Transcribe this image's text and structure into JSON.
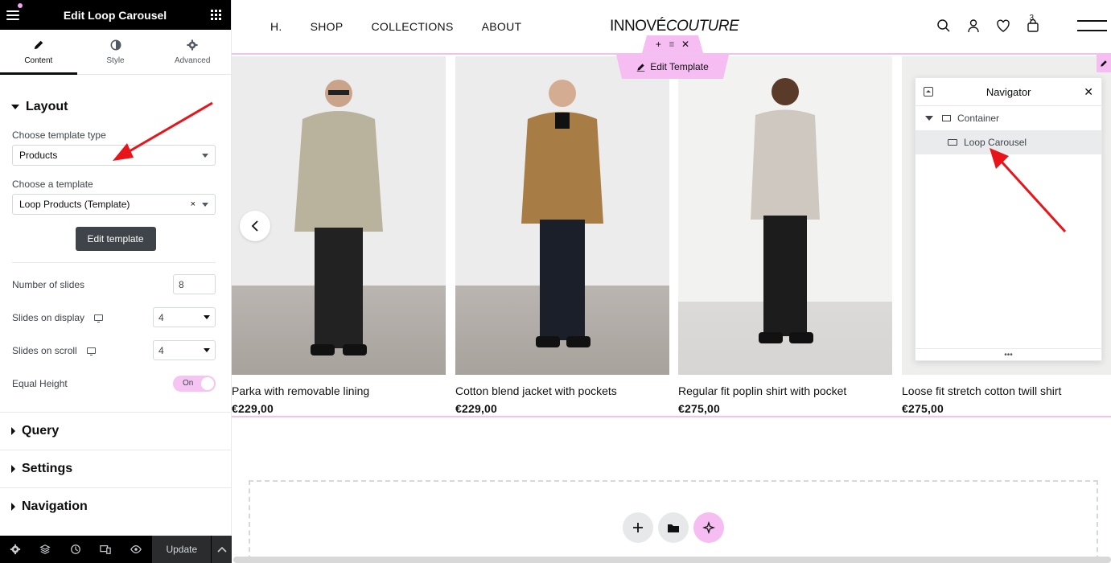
{
  "editor": {
    "title": "Edit Loop Carousel",
    "tabs": [
      {
        "label": "Content",
        "icon": "pencil-icon"
      },
      {
        "label": "Style",
        "icon": "contrast-icon"
      },
      {
        "label": "Advanced",
        "icon": "gear-icon"
      }
    ],
    "layout": {
      "heading": "Layout",
      "template_type_label": "Choose template type",
      "template_type_value": "Products",
      "template_label": "Choose a template",
      "template_value": "Loop Products (Template)",
      "edit_button": "Edit template",
      "slides_label": "Number of slides",
      "slides_value": "8",
      "display_label": "Slides on display",
      "display_value": "4",
      "scroll_label": "Slides on scroll",
      "scroll_value": "4",
      "equal_height_label": "Equal Height",
      "equal_height_value": "On"
    },
    "sections": [
      "Query",
      "Settings",
      "Navigation"
    ],
    "footer": {
      "update_label": "Update"
    }
  },
  "site": {
    "nav_links": [
      "H.",
      "SHOP",
      "COLLECTIONS",
      "ABOUT"
    ],
    "logo_a": "INNOVÉ",
    "logo_b": "COUTURE",
    "cart_count": "3",
    "edit_template_label": "Edit Template"
  },
  "products": [
    {
      "name": "Parka with removable lining",
      "price": "€229,00",
      "coat": "#b9b39e"
    },
    {
      "name": "Cotton blend jacket with pockets",
      "price": "€229,00",
      "coat": "#a77c45"
    },
    {
      "name": "Regular fit poplin shirt with pocket",
      "price": "€275,00",
      "coat": "#cfc8c0"
    },
    {
      "name": "Loose fit stretch cotton twill shirt",
      "price": "€275,00",
      "coat": "#d6d0c6"
    }
  ],
  "navigator": {
    "title": "Navigator",
    "items": [
      {
        "label": "Container"
      },
      {
        "label": "Loop Carousel"
      }
    ]
  },
  "colors": {
    "accent_pink": "#f5bdf2",
    "annotation_red": "#e8141a"
  }
}
